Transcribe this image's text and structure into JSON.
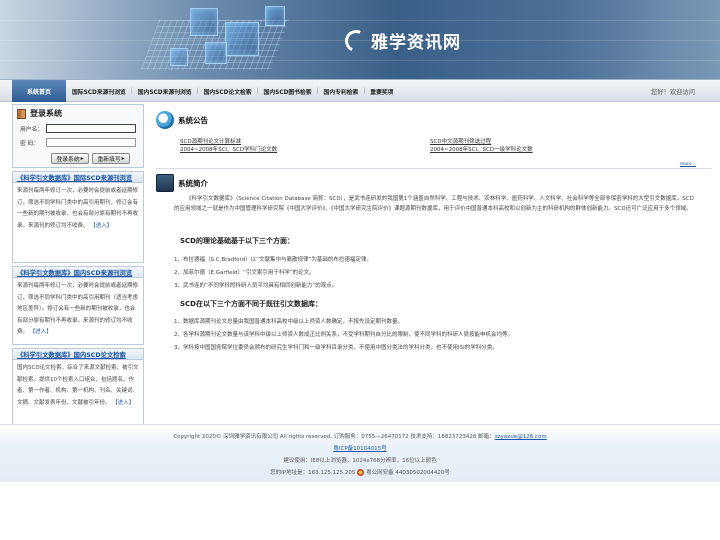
{
  "banner": {
    "logo_text": "雅学资讯网",
    "logo_icon": "swirl-logo-icon"
  },
  "nav": {
    "home": "系统首页",
    "items": [
      "国际SCD来源刊浏览",
      "国内SCD来源刊浏览",
      "国内SCD论文检索",
      "国内SCD图书检索",
      "国内专利检索",
      "重要奖项"
    ],
    "greeting": "您好！欢迎访问"
  },
  "login": {
    "title": "登录系统",
    "username_label": "用户名：",
    "password_label": "密  码：",
    "username_value": "",
    "password_value": "",
    "login_button": "登录系统",
    "reset_button": "重新填写"
  },
  "boxes": [
    {
      "title": "《科学引文数据库》国际SCD来源刊浏览",
      "text": "来源刊每两年修订一次，必要时会提前或者延期修订，筛选不同学科门类中的高引用期刊，修订会有一些新的期刊被收录，也会有部分原有期刊不再收录。来源刊的修订均不收费。",
      "link": "【进入】"
    },
    {
      "title": "《科学引文数据库》国内SCD来源刊浏览",
      "text": "来源刊每两年修订一次，必要时会提前或者延期修订，筛选不同学科门类中的高引用期刊（适当考虑地区差异）。修订会有一些新的期刊被收录，也会有部分原有期刊不再收录。来源刊的修订均不收费。",
      "link": "【进入】"
    },
    {
      "title": "《科学引文数据库》国内SCD论文检索",
      "text": "国内SCD论文检索，综合了来源文献检索、被引文献检索。提供10个检索入口组合，包括题名、作者、第一作者、机构、第一机构、刊名、关键词、文摘、文献发表年份、文献被引年份。",
      "link": "【进入】"
    }
  ],
  "notice": {
    "title": "系统公告",
    "links": [
      "SCD源期刊论文计算标准",
      "SCD中文源期刊筛选过程",
      "2004~2008年SCI、SCD学科门论文数",
      "2004~2008年SCI、SCD一级学科论文数"
    ],
    "more": "more..."
  },
  "intro": {
    "title": "系统简介",
    "para1": "《科学引文数据库》（Science Citation Database 简称：SCD），是武书连研发的我国第1个涵盖自然科学、工程与技术、农林科学、医药科学、人文科学、社会科学等全部非保密学科的大型引文数据库。SCD的应用领域之一就是作为中国管理科学研究院《中国大学评价》、《中国大学研究生院评价》课题源期刊数据库，用于评价中国普通本科高校和以创新为主的科研机构的群体创新能力。SCD还可广泛应用于多个领域。",
    "h1": "SCD的理论基础基于以下三个方面：",
    "list1": [
      "1、布拉德福（S.C.Bradford）以“文献集中与离散规律”为基础的布拉德福定律。",
      "2、加菲尔德（E.Garfield）“引文索引用于科学”的论文。",
      "3、武书连的“不同学科的科研人员平均具有相同创新能力”的观点。"
    ],
    "h2": "SCD在以下三个方面不同于既往引文数据库：",
    "list2": [
      "1、数据库源期刊论文总量由我国普通本科高校中级以上师资人数确定，不按先设定期刊数量。",
      "2、各学科源期刊论文数量与该学科中级以上师资人数成正比例关系，不受学科期刊自分比的限制，使不同学科的科研人员按能申机会均等。",
      "3、学科按中国国务院学位委员会颁布的研究生学科门和一级学科目录分类，不使用中图分类法的学科分类，也不使用ISI的学科分类。"
    ]
  },
  "footer": {
    "copyright": "Copyright 2020© 深圳雅学资讯有限公司 All rights reserved.   订购服务：0755—26470172   技术支持：18823723426   邮箱：",
    "email": "szyaxue@126.com",
    "icp": "粤ICP备10104015号",
    "browser": "建议使用：IE8以上浏览器，1024x768分辨率，16位以上颜色",
    "ip": "您的IP地址是：163.125.125.205",
    "police": "粤公网安备 44030502004420号"
  },
  "colors": {
    "accent": "#1a57a8",
    "nav_home": "#2f5d92",
    "banner": "#3a5f86"
  }
}
